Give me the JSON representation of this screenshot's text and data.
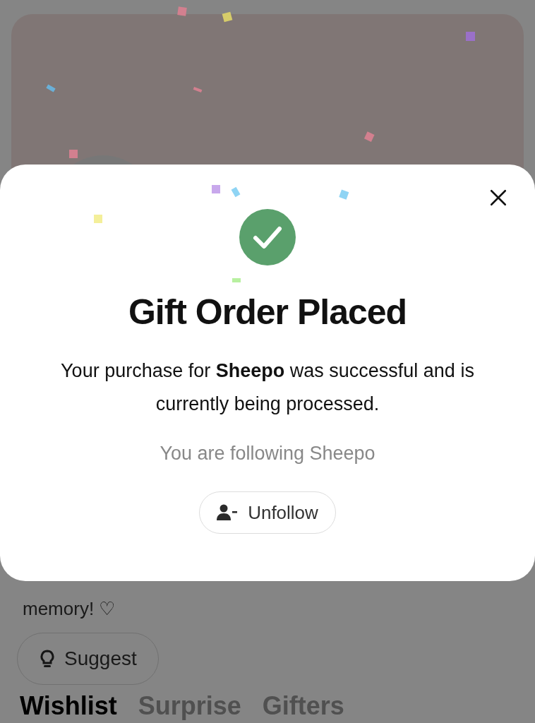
{
  "profile": {
    "bio": "memory! ♡",
    "suggest_button": "Suggest"
  },
  "tabs": [
    {
      "label": "Wishlist",
      "selected": true
    },
    {
      "label": "Surprise",
      "selected": false
    },
    {
      "label": "Gifters",
      "selected": false
    }
  ],
  "modal": {
    "title": "Gift Order Placed",
    "message": "Your purchase for **Sheepo** was successful and is currently being processed.",
    "following_note": "You are following Sheepo",
    "unfollow_button": "Unfollow"
  }
}
